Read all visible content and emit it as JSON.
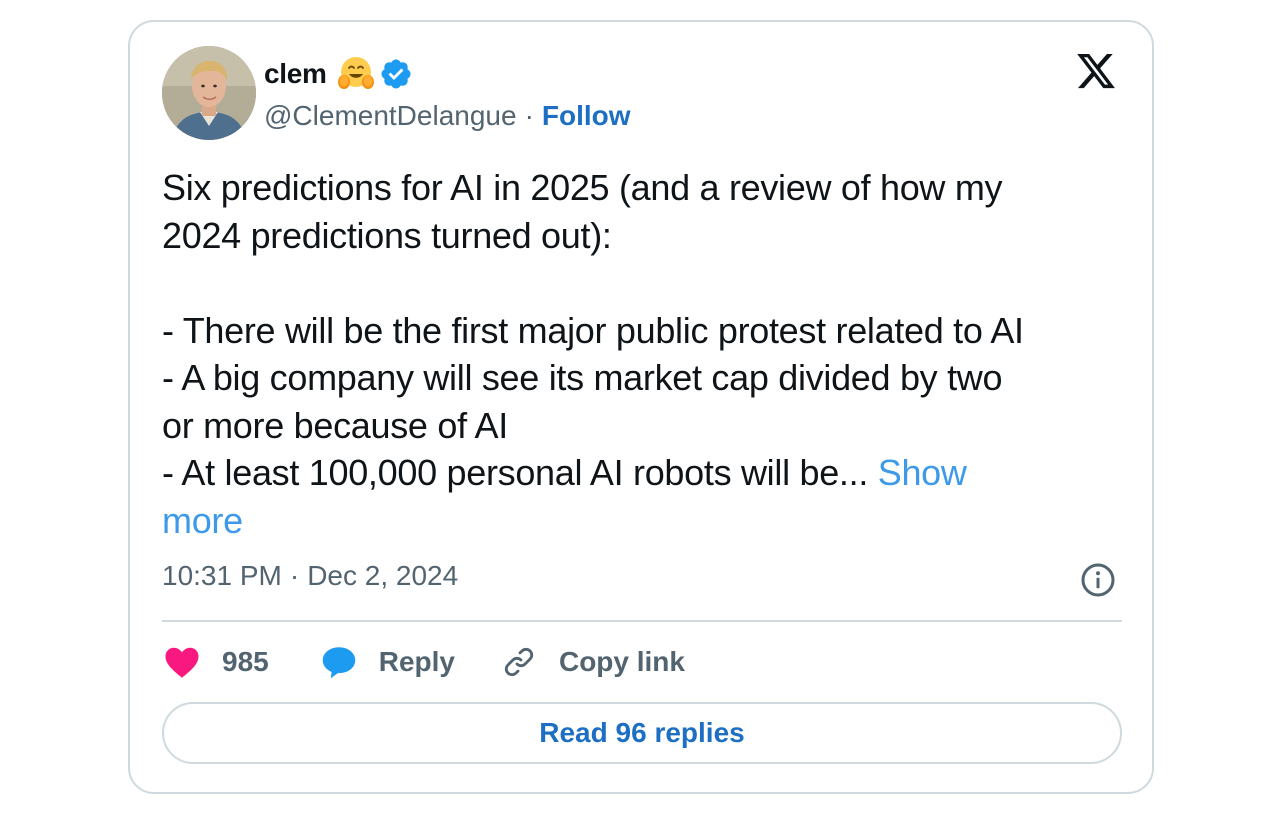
{
  "author": {
    "display_name": "clem",
    "handle": "@ClementDelangue",
    "separator": "·",
    "follow_label": "Follow",
    "emoji_icon": "hugging-face-emoji",
    "verified_icon": "verified-badge-icon"
  },
  "tweet": {
    "lines": [
      "Six predictions for AI in 2025 (and a review of how my",
      "2024 predictions turned out):",
      "",
      "- There will be the first major public protest related to AI",
      "- A big company will see its market cap divided by two",
      "or more because of AI",
      "- At least 100,000 personal AI robots will be... "
    ],
    "show_more_a": "Show",
    "show_more_b": "more"
  },
  "meta": {
    "time": "10:31 PM",
    "separator": "·",
    "date": "Dec 2, 2024"
  },
  "actions": {
    "like_count": "985",
    "reply_label": "Reply",
    "copy_link_label": "Copy link"
  },
  "read_replies_label": "Read 96 replies",
  "colors": {
    "like": "#f91880",
    "reply": "#1d9bf0",
    "link": "#1d6fc4",
    "show_more": "#3e9ae8",
    "secondary_text": "#536471",
    "border": "#cfd9de"
  }
}
